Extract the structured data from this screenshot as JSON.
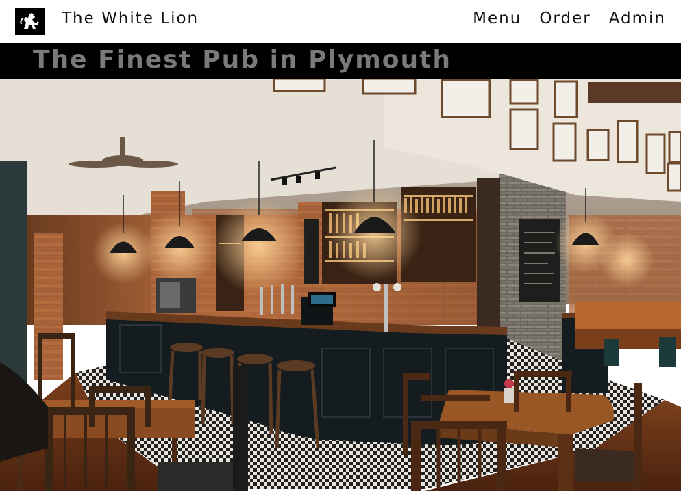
{
  "site": {
    "brand": "The White Lion",
    "logo_icon": "lion-rampant-icon"
  },
  "nav": {
    "items": [
      {
        "label": "Menu"
      },
      {
        "label": "Order"
      },
      {
        "label": "Admin"
      }
    ]
  },
  "banner": {
    "title": "The Finest Pub in Plymouth"
  },
  "hero": {
    "image_icon": "pub-interior-photo"
  },
  "colors": {
    "banner_bg": "#000000",
    "banner_text": "#7a7a7a",
    "nav_text": "#111111"
  }
}
